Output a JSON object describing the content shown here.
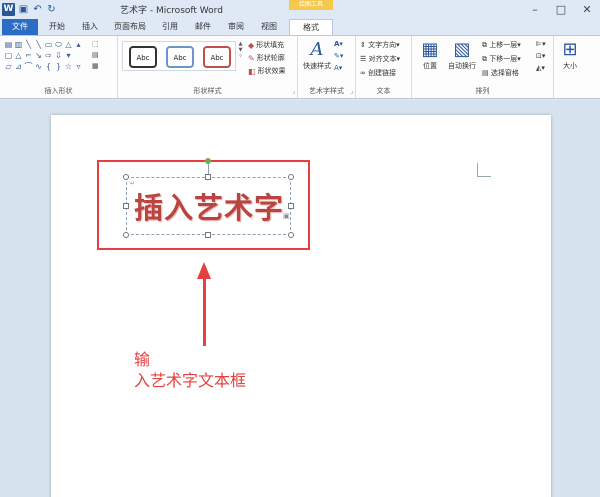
{
  "window": {
    "title": "艺术字 - Microsoft Word",
    "context_tools_label": "绘图工具",
    "logo_letter": "W",
    "controls": {
      "minimize": "–",
      "maximize": "□",
      "close": "✕"
    }
  },
  "quick_access": {
    "save_icon": "save-icon",
    "undo_icon": "undo-icon",
    "redo_icon": "redo-icon"
  },
  "tabs": [
    {
      "label": "文件"
    },
    {
      "label": "开始"
    },
    {
      "label": "插入"
    },
    {
      "label": "页面布局"
    },
    {
      "label": "引用"
    },
    {
      "label": "邮件"
    },
    {
      "label": "审阅"
    },
    {
      "label": "视图"
    },
    {
      "label": "格式"
    }
  ],
  "ribbon": {
    "insert_shapes": {
      "label": "插入形状"
    },
    "shape_styles": {
      "label": "形状样式",
      "preset_label": "Abc",
      "fill": "形状填充",
      "outline": "形状轮廓",
      "effects": "形状效果"
    },
    "wordart_styles": {
      "label": "艺术字样式",
      "quick_styles": "快速样式"
    },
    "text": {
      "label": "文本",
      "direction": "文字方向",
      "align": "对齐文本",
      "link": "创建链接"
    },
    "arrange": {
      "label": "排列",
      "position": "位置",
      "wrap": "自动换行",
      "bring_forward": "上移一层",
      "send_backward": "下移一层",
      "selection_pane": "选择窗格"
    },
    "size": {
      "label": "大小"
    }
  },
  "document": {
    "wordart_text": "插入艺术字",
    "annotation_line1": "输",
    "annotation_line2": "入艺术字文本框"
  },
  "colors": {
    "accent_blue": "#2b579a",
    "file_tab": "#2b6cc4",
    "highlight_red": "#e53f3f",
    "wordart_red": "#b94440",
    "context_yellow": "#f6c94c"
  }
}
